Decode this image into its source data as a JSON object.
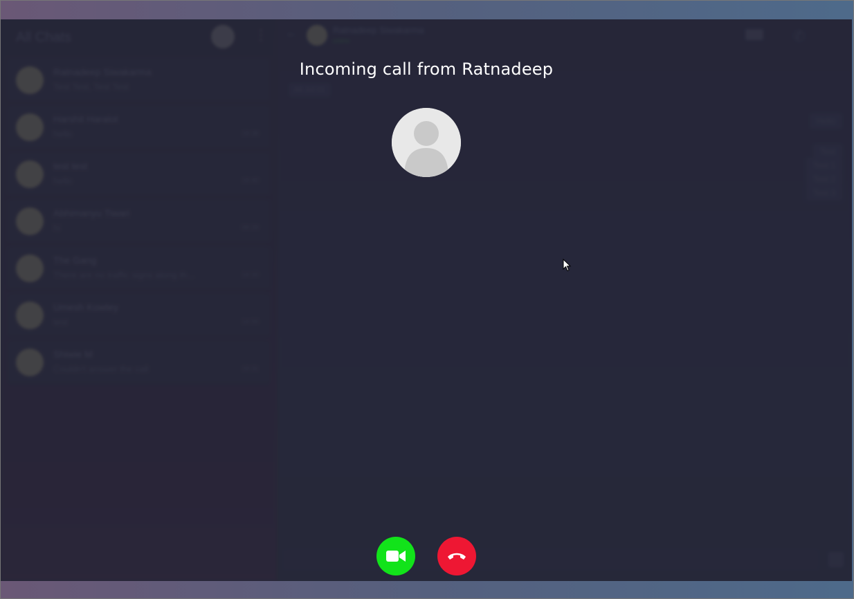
{
  "background_app": {
    "sidebar": {
      "title": "All Chats",
      "chats": [
        {
          "name": "Ratnadeep Siwakarma",
          "preview": "Test Test, Test Test",
          "time": ""
        },
        {
          "name": "Harshit Haralot",
          "preview": "hello",
          "time": "19:38"
        },
        {
          "name": "test test",
          "preview": "hello",
          "time": "19:40"
        },
        {
          "name": "Abhimanyu Tiwari",
          "preview": "hi",
          "time": "08:29"
        },
        {
          "name": "The Gang",
          "preview": "There are no traffic signs along th...",
          "time": "14:10"
        },
        {
          "name": "Umesh Kowtey",
          "preview": "test",
          "time": "14:56"
        },
        {
          "name": "Shiwie M",
          "preview": "Couldn't answer the call",
          "time": "19:31"
        }
      ]
    },
    "conversation": {
      "contact_name": "Ratnadeep Siwakarma",
      "status": "online",
      "date_chip": "All Jul 01",
      "messages": [
        "Hello",
        "Test",
        "Test 1",
        "Test 2",
        "Test 3"
      ],
      "composer_placeholder": "Enter some text..."
    }
  },
  "call": {
    "title": "Incoming call from Ratnadeep",
    "accept_video_icon": "video-camera-icon",
    "decline_icon": "phone-hangup-icon"
  },
  "colors": {
    "accept": "#12e31a",
    "decline": "#ee1733",
    "avatar_bg": "#e8e8e8"
  }
}
